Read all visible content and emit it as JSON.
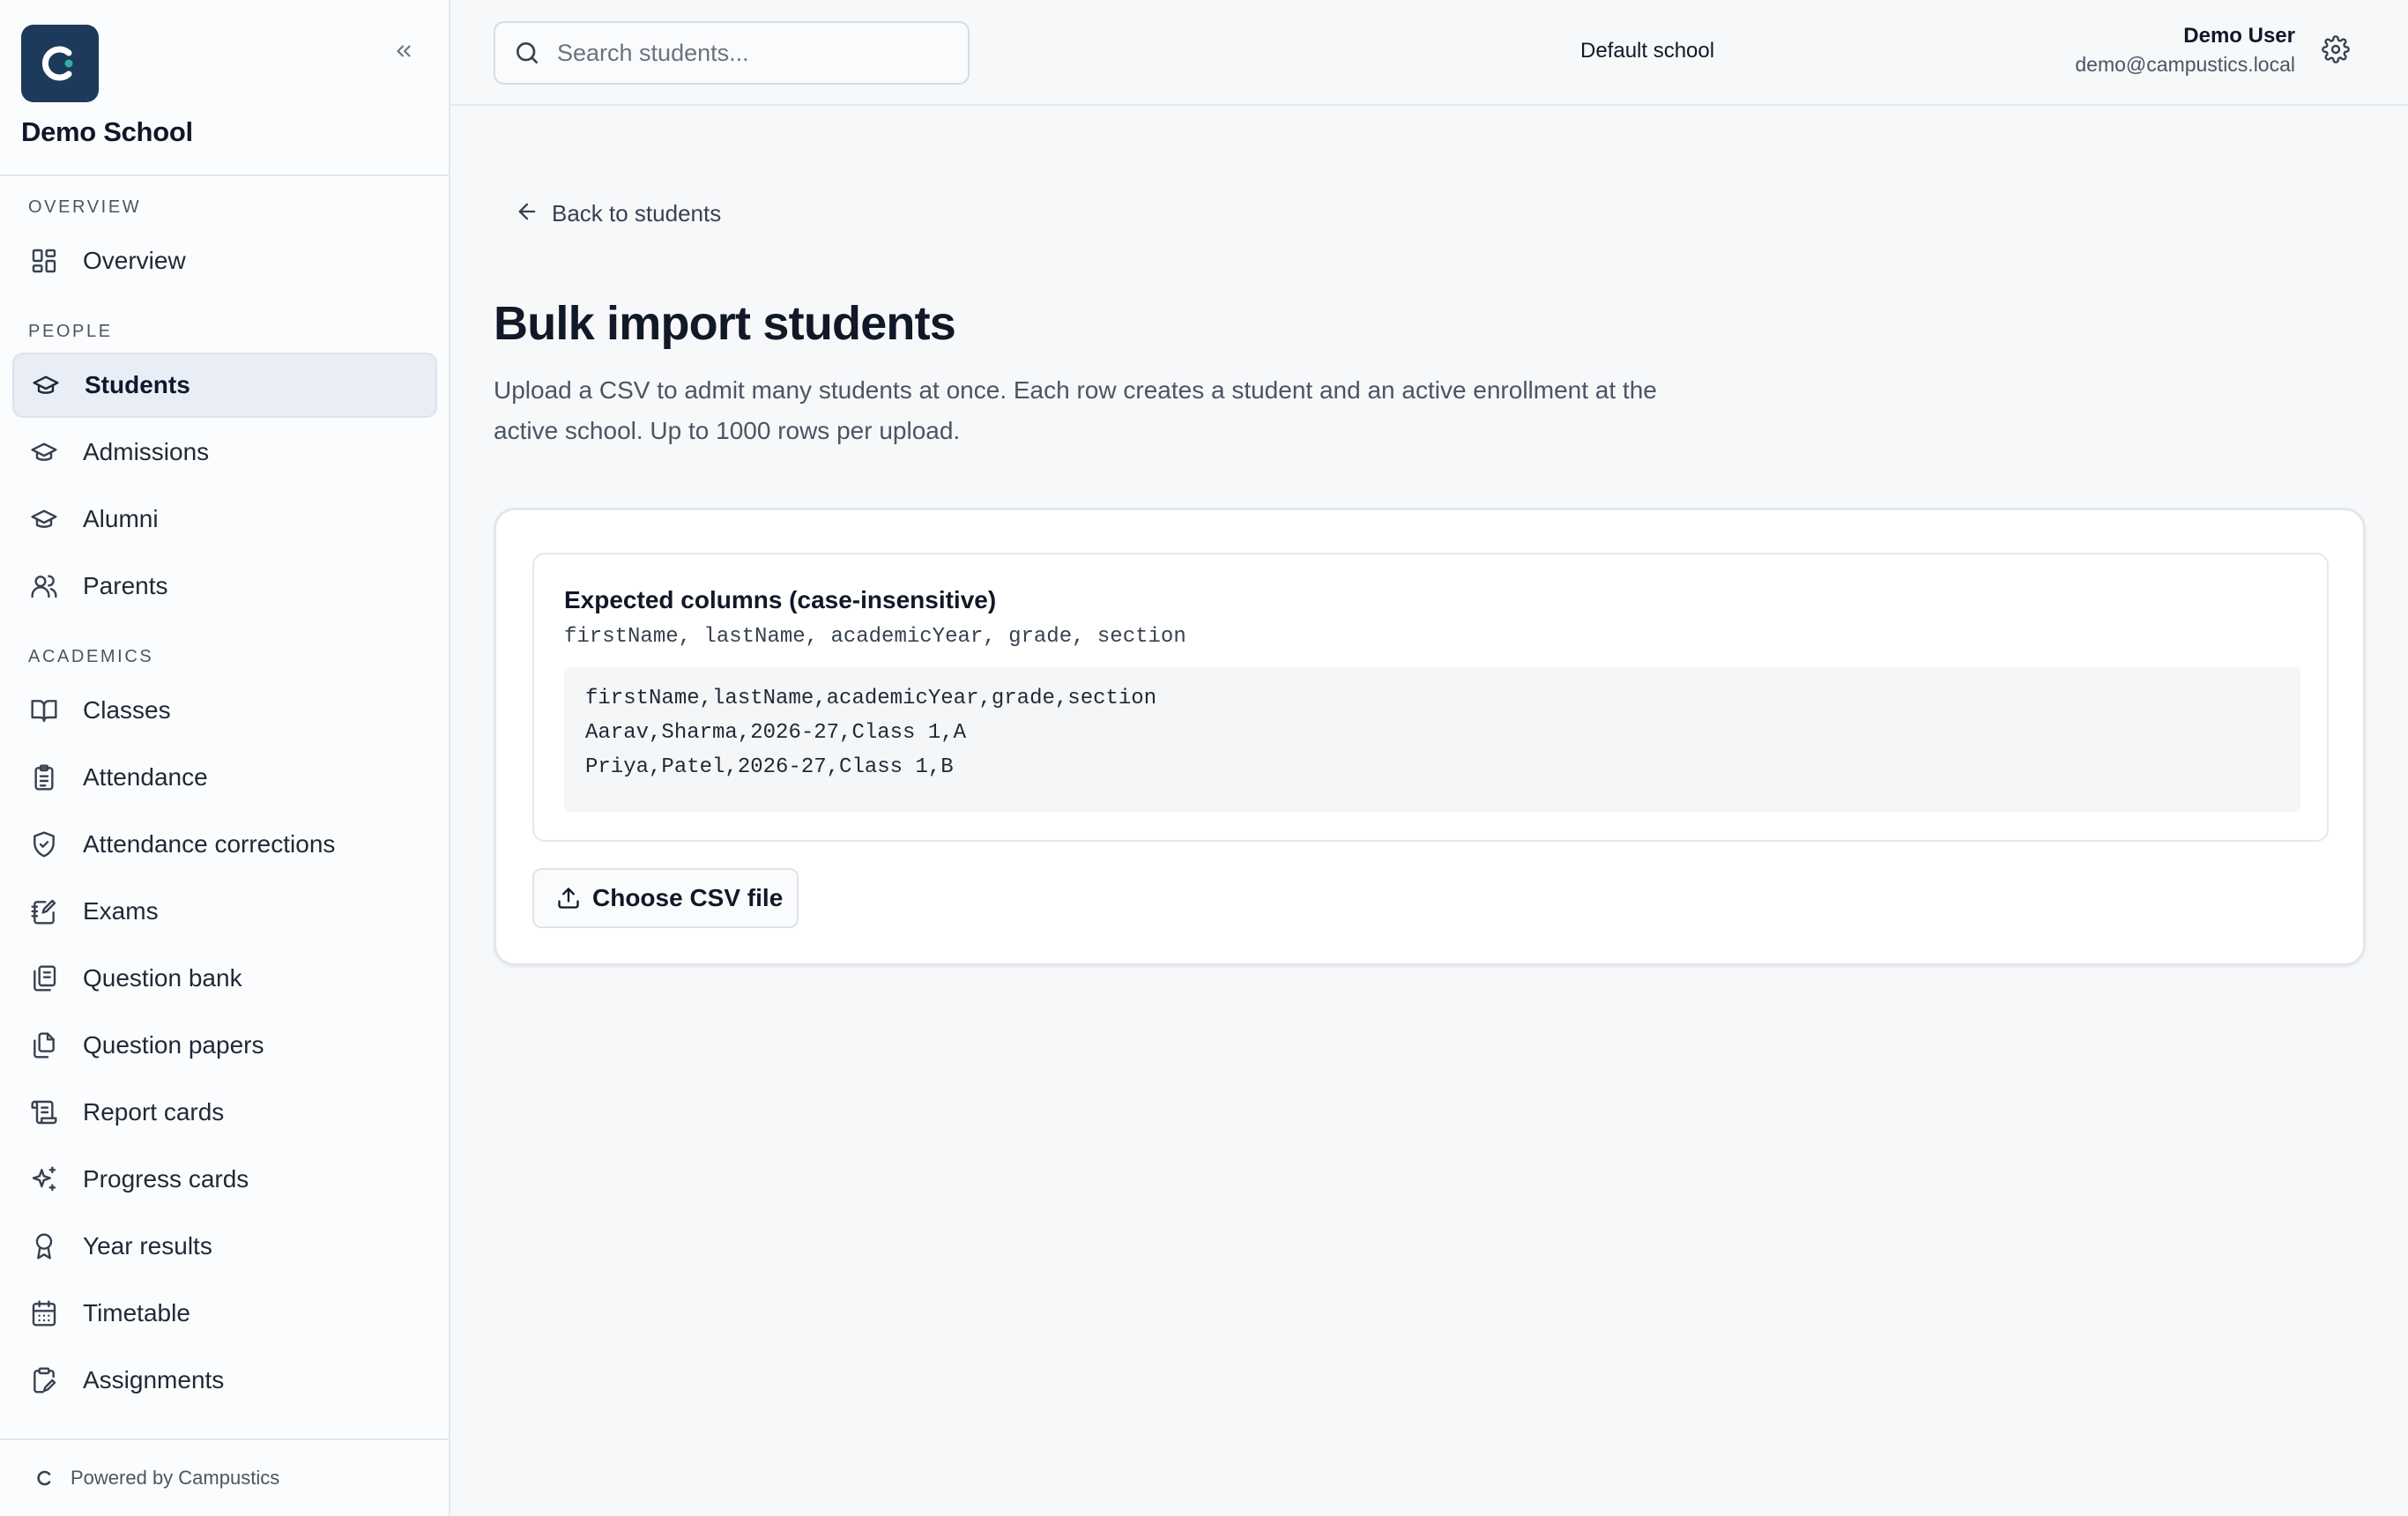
{
  "app": {
    "school_name": "Demo School",
    "footer": "Powered by Campustics"
  },
  "sidebar": {
    "sections": [
      {
        "label": "OVERVIEW"
      },
      {
        "label": "PEOPLE"
      },
      {
        "label": "ACADEMICS"
      }
    ],
    "items": [
      {
        "label": "Overview",
        "icon": "grid-icon"
      },
      {
        "label": "Students",
        "icon": "graduation-cap-icon",
        "active": true
      },
      {
        "label": "Admissions",
        "icon": "graduation-cap-icon"
      },
      {
        "label": "Alumni",
        "icon": "graduation-cap-icon"
      },
      {
        "label": "Parents",
        "icon": "users-icon"
      },
      {
        "label": "Classes",
        "icon": "book-open-icon"
      },
      {
        "label": "Attendance",
        "icon": "clipboard-list-icon"
      },
      {
        "label": "Attendance corrections",
        "icon": "shield-check-icon"
      },
      {
        "label": "Exams",
        "icon": "notebook-pen-icon"
      },
      {
        "label": "Question bank",
        "icon": "library-icon"
      },
      {
        "label": "Question papers",
        "icon": "files-icon"
      },
      {
        "label": "Report cards",
        "icon": "scroll-text-icon"
      },
      {
        "label": "Progress cards",
        "icon": "sparkles-icon"
      },
      {
        "label": "Year results",
        "icon": "award-icon"
      },
      {
        "label": "Timetable",
        "icon": "calendar-icon"
      },
      {
        "label": "Assignments",
        "icon": "clipboard-pen-icon"
      }
    ]
  },
  "topbar": {
    "search_placeholder": "Search students...",
    "school": "Default school",
    "user_name": "Demo User",
    "user_email": "demo@campustics.local"
  },
  "page": {
    "back_label": "Back to students",
    "title": "Bulk import students",
    "description": "Upload a CSV to admit many students at once. Each row creates a student and an active enrollment at the active school. Up to 1000 rows per upload.",
    "expected_title": "Expected columns (case-insensitive)",
    "expected_columns": "firstName, lastName, academicYear, grade, section",
    "sample_lines": [
      "firstName,lastName,academicYear,grade,section",
      "Aarav,Sharma,2026-27,Class 1,A",
      "Priya,Patel,2026-27,Class 1,B"
    ],
    "choose_button": "Choose CSV file"
  },
  "colors": {
    "brand": "#1d3a5c",
    "accent_dot": "#2bb3a3",
    "active_bg": "#e9eef6"
  }
}
